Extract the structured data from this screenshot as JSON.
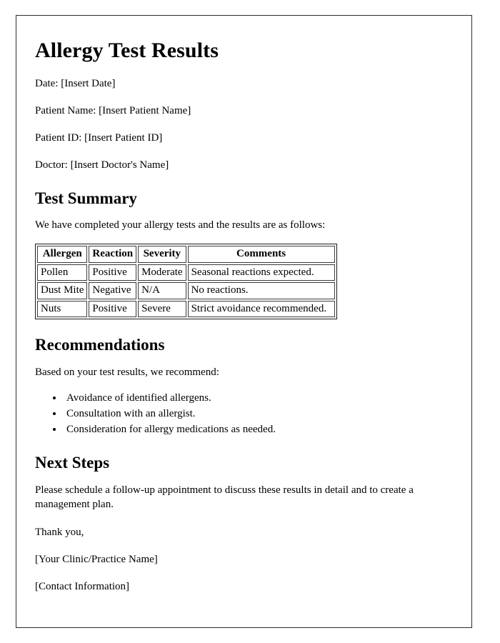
{
  "document": {
    "title": "Allergy Test Results",
    "meta": [
      {
        "label": "Date:",
        "value": "[Insert Date]",
        "text": "Date: [Insert Date]"
      },
      {
        "label": "Patient Name:",
        "value": "[Insert Patient Name]",
        "text": "Patient Name: [Insert Patient Name]"
      },
      {
        "label": "Patient ID:",
        "value": "[Insert Patient ID]",
        "text": "Patient ID: [Insert Patient ID]"
      },
      {
        "label": "Doctor:",
        "value": "[Insert Doctor's Name]",
        "text": "Doctor: [Insert Doctor's Name]"
      }
    ],
    "test_summary": {
      "heading": "Test Summary",
      "intro": "We have completed your allergy tests and the results are as follows:",
      "table": {
        "headers": [
          "Allergen",
          "Reaction",
          "Severity",
          "Comments"
        ],
        "rows": [
          [
            "Pollen",
            "Positive",
            "Moderate",
            "Seasonal reactions expected."
          ],
          [
            "Dust Mite",
            "Negative",
            "N/A",
            "No reactions."
          ],
          [
            "Nuts",
            "Positive",
            "Severe",
            "Strict avoidance recommended."
          ]
        ]
      }
    },
    "recommendations": {
      "heading": "Recommendations",
      "intro": "Based on your test results, we recommend:",
      "items": [
        "Avoidance of identified allergens.",
        "Consultation with an allergist.",
        "Consideration for allergy medications as needed."
      ]
    },
    "next_steps": {
      "heading": "Next Steps",
      "paragraph": "Please schedule a follow-up appointment to discuss these results in detail and to create a management plan.",
      "thanks": "Thank you,",
      "clinic": "[Your Clinic/Practice Name]",
      "contact": "[Contact Information]"
    }
  },
  "colors": {
    "page_background": "#ffffff",
    "text": "#000000",
    "page_border": "#2b2b2b",
    "table_border": "#3a3a3a"
  }
}
